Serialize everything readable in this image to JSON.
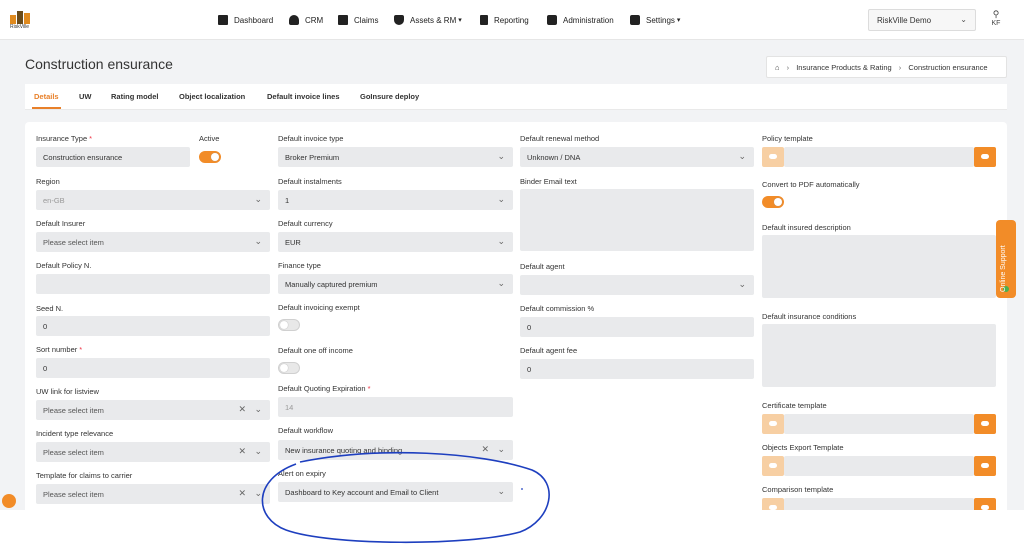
{
  "app": {
    "logo_text": "RiskVille"
  },
  "nav": {
    "items": [
      {
        "label": "Dashboard",
        "icon": "dashboard-icon"
      },
      {
        "label": "CRM",
        "icon": "person-icon"
      },
      {
        "label": "Claims",
        "icon": "claims-icon"
      },
      {
        "label": "Assets & RM",
        "icon": "shield-icon"
      },
      {
        "label": "Reporting",
        "icon": "document-icon"
      },
      {
        "label": "Administration",
        "icon": "gear-icon"
      },
      {
        "label": "Settings",
        "icon": "settings-icon"
      }
    ],
    "tenant": "RiskVille Demo",
    "user_initials": "KF"
  },
  "page": {
    "title": "Construction ensurance",
    "breadcrumb": [
      "Insurance Products & Rating",
      "Construction ensurance"
    ]
  },
  "tabs": [
    "Details",
    "UW",
    "Rating model",
    "Object localization",
    "Default invoice lines",
    "GoInsure deploy"
  ],
  "form": {
    "insurance_type": {
      "label": "Insurance Type",
      "value": "Construction ensurance"
    },
    "active": {
      "label": "Active",
      "on": true
    },
    "region": {
      "label": "Region",
      "value": "en-GB"
    },
    "default_insurer": {
      "label": "Default Insurer",
      "placeholder": "Please select item"
    },
    "default_policy_n": {
      "label": "Default Policy N."
    },
    "seed_n": {
      "label": "Seed N.",
      "value": "0"
    },
    "sort_number": {
      "label": "Sort number",
      "value": "0"
    },
    "uw_link": {
      "label": "UW link for listview",
      "placeholder": "Please select item"
    },
    "incident_type": {
      "label": "Incident type relevance",
      "placeholder": "Please select item"
    },
    "template_claims": {
      "label": "Template for claims to carrier",
      "placeholder": "Please select item"
    },
    "default_invoice_type": {
      "label": "Default invoice type",
      "value": "Broker Premium"
    },
    "default_instalments": {
      "label": "Default instalments",
      "value": "1"
    },
    "default_currency": {
      "label": "Default currency",
      "value": "EUR"
    },
    "finance_type": {
      "label": "Finance type",
      "value": "Manually captured premium"
    },
    "invoicing_exempt": {
      "label": "Default invoicing exempt",
      "on": false
    },
    "one_off_income": {
      "label": "Default one off income",
      "on": false
    },
    "quoting_expiration": {
      "label": "Default Quoting Expiration",
      "value": "14"
    },
    "default_workflow": {
      "label": "Default workflow",
      "value": "New insurance quoting and binding"
    },
    "alert_on_expiry": {
      "label": "Alert on expiry",
      "value": "Dashboard to Key account and Email to Client"
    },
    "renewal_method": {
      "label": "Default renewal method",
      "value": "Unknown / DNA"
    },
    "binder_email": {
      "label": "Binder Email text"
    },
    "default_agent": {
      "label": "Default agent"
    },
    "default_commission": {
      "label": "Default commission %",
      "value": "0"
    },
    "default_agent_fee": {
      "label": "Default agent fee",
      "value": "0"
    },
    "policy_template": {
      "label": "Policy template"
    },
    "convert_pdf": {
      "label": "Convert to PDF automatically",
      "on": true
    },
    "insured_description": {
      "label": "Default insured description"
    },
    "insurance_conditions": {
      "label": "Default insurance conditions"
    },
    "certificate_template": {
      "label": "Certificate template"
    },
    "objects_export": {
      "label": "Objects Export Template"
    },
    "comparison_template": {
      "label": "Comparison template"
    }
  },
  "support": {
    "label": "Online Support"
  },
  "colors": {
    "accent": "#f28c28",
    "field_bg": "#e9eaec"
  }
}
